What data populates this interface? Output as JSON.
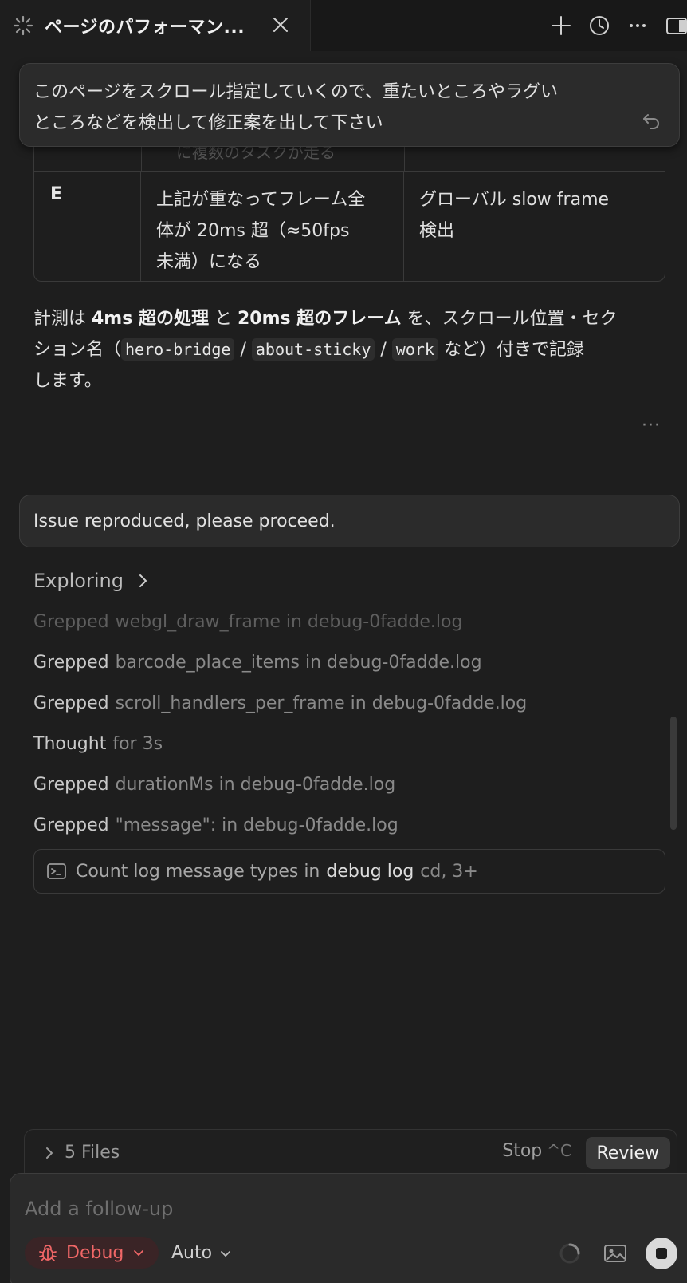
{
  "tab": {
    "title": "ページのパフォーマン...",
    "icons": [
      "spinner-icon",
      "close-icon"
    ]
  },
  "toolbar": {
    "icons": [
      "plus-icon",
      "history-icon",
      "more-icon",
      "panel-toggle-icon"
    ]
  },
  "pinned_message": {
    "text_line1": "このページをスクロール指定していくので、重たいところやラグい",
    "text_line2": "ところなどを検出して修正案を出して下さい",
    "icon": "undo-icon"
  },
  "table": {
    "cut_text": "に複数のタスクが走る",
    "row": {
      "key": "E",
      "condition_line1": "上記が重なってフレーム全",
      "condition_line2": "体が 20ms 超（≈50fps",
      "condition_line3": "未満）になる",
      "detection_line1": "グローバル slow frame",
      "detection_line2": "検出"
    }
  },
  "paragraph": {
    "p1": "計測は ",
    "b1": "4ms 超の処理",
    "p2": " と ",
    "b2": "20ms 超のフレーム",
    "p3": " を、スクロール位置・セク",
    "p4": "ション名（",
    "c1": "hero-bridge",
    "sep1": " / ",
    "c2": "about-sticky",
    "sep2": " / ",
    "c3": "work",
    "p5": " など）付きで記録",
    "p6": "します。",
    "more": "···"
  },
  "user_message_2": {
    "text": "Issue reproduced, please proceed."
  },
  "exploring": {
    "label": "Exploring",
    "items": [
      {
        "verb": "Grepped",
        "detail": "webgl_draw_frame in debug-0fadde.log"
      },
      {
        "verb": "Grepped",
        "detail": "barcode_place_items in debug-0fadde.log"
      },
      {
        "verb": "Grepped",
        "detail": "scroll_handlers_per_frame in debug-0fadde.log"
      },
      {
        "verb": "Thought",
        "detail": "for 3s"
      },
      {
        "verb": "Grepped",
        "detail": "durationMs in debug-0fadde.log"
      },
      {
        "verb": "Grepped",
        "detail": "\"message\": in debug-0fadde.log"
      }
    ]
  },
  "command": {
    "t1": "Count log message types in",
    "t2": "debug log",
    "t3": "cd, 3+"
  },
  "files_bar": {
    "files_label": "5 Files",
    "stop_label": "Stop",
    "stop_shortcut": "^C",
    "review_label": "Review"
  },
  "composer": {
    "placeholder": "Add a follow-up",
    "mode_label": "Debug",
    "model_label": "Auto"
  },
  "colors": {
    "background": "#1e1e1e",
    "debug_accent": "#f06767"
  }
}
